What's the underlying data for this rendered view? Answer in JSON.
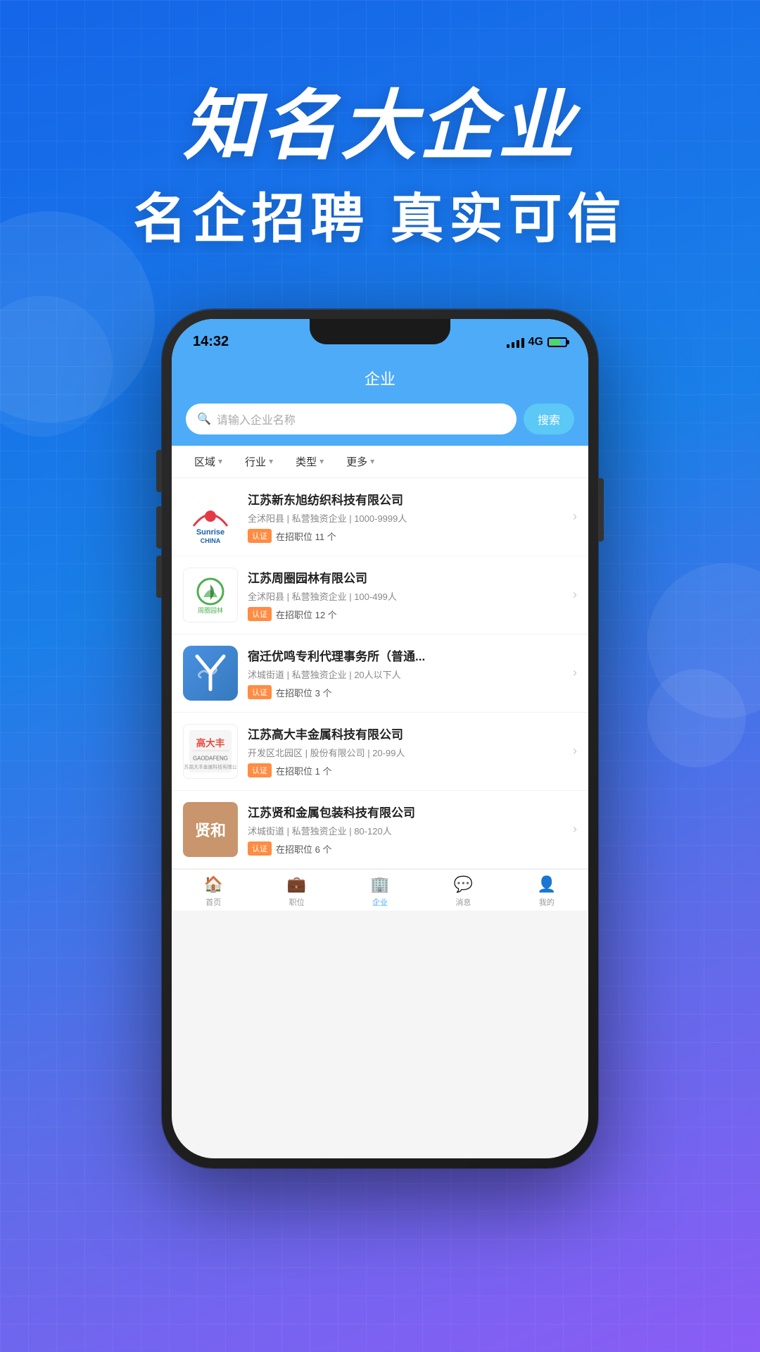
{
  "background": {
    "gradient_start": "#1565e8",
    "gradient_end": "#8b5cf6"
  },
  "header": {
    "title_line1": "知名大企业",
    "title_line2": "名企招聘  真实可信"
  },
  "phone": {
    "status_bar": {
      "time": "14:32",
      "network": "4G"
    },
    "app_title": "企业",
    "search": {
      "placeholder": "请输入企业名称",
      "button_label": "搜索"
    },
    "filters": [
      {
        "label": "区域",
        "id": "filter-area"
      },
      {
        "label": "行业",
        "id": "filter-industry"
      },
      {
        "label": "类型",
        "id": "filter-type"
      },
      {
        "label": "更多",
        "id": "filter-more"
      }
    ],
    "companies": [
      {
        "id": "company-1",
        "name": "江苏新东旭纺织科技有限公司",
        "meta": "全沭阳县 | 私营独资企业 | 1000-9999人",
        "auth_label": "认证",
        "jobs_text": "在招职位 11 个",
        "logo_type": "sunrise"
      },
      {
        "id": "company-2",
        "name": "江苏周圈园林有限公司",
        "meta": "全沭阳县 | 私营独资企业 | 100-499人",
        "auth_label": "认证",
        "jobs_text": "在招职位 12 个",
        "logo_type": "zhouwei"
      },
      {
        "id": "company-3",
        "name": "宿迁优鸣专利代理事务所（普通...",
        "meta": "沭城街道 | 私营独资企业 | 20人以下人",
        "auth_label": "认证",
        "jobs_text": "在招职位 3 个",
        "logo_type": "ys"
      },
      {
        "id": "company-4",
        "name": "江苏高大丰金属科技有限公司",
        "meta": "开发区北园区 | 股份有限公司 | 20-99人",
        "auth_label": "认证",
        "jobs_text": "在招职位 1 个",
        "logo_type": "gdf"
      },
      {
        "id": "company-5",
        "name": "江苏贤和金属包装科技有限公司",
        "meta": "沭城街道 | 私营独资企业 | 80-120人",
        "auth_label": "认证",
        "jobs_text": "在招职位 6 个",
        "logo_type": "xh"
      }
    ],
    "bottom_nav": [
      {
        "label": "首页",
        "icon": "🏠"
      },
      {
        "label": "职位",
        "icon": "💼"
      },
      {
        "label": "企业",
        "icon": "🏢",
        "active": true
      },
      {
        "label": "消息",
        "icon": "💬"
      },
      {
        "label": "我的",
        "icon": "👤"
      }
    ]
  }
}
